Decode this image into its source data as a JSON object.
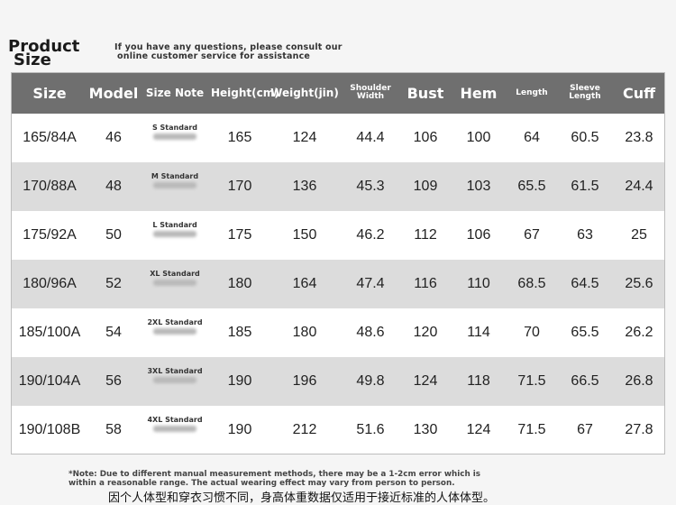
{
  "header": {
    "title_line1": "Product",
    "title_line2": "Size",
    "consult_line1": "If you have any questions, please consult our",
    "consult_line2": "online customer service for assistance"
  },
  "columns": [
    {
      "key": "size",
      "label": "Size"
    },
    {
      "key": "model",
      "label": "Model"
    },
    {
      "key": "note",
      "label": "Size Note"
    },
    {
      "key": "height",
      "label": "Height(cm)"
    },
    {
      "key": "weight",
      "label": "Weight(jin)"
    },
    {
      "key": "shoulder",
      "label": "Shoulder Width"
    },
    {
      "key": "bust",
      "label": "Bust"
    },
    {
      "key": "hem",
      "label": "Hem"
    },
    {
      "key": "length",
      "label": "Length"
    },
    {
      "key": "sleeve",
      "label": "Sleeve Length"
    },
    {
      "key": "cuff",
      "label": "Cuff"
    }
  ],
  "rows": [
    {
      "size": "165/84A",
      "model": "46",
      "note": "S Standard",
      "height": "165",
      "weight": "124",
      "shoulder": "44.4",
      "bust": "106",
      "hem": "100",
      "length": "64",
      "sleeve": "60.5",
      "cuff": "23.8"
    },
    {
      "size": "170/88A",
      "model": "48",
      "note": "M Standard",
      "height": "170",
      "weight": "136",
      "shoulder": "45.3",
      "bust": "109",
      "hem": "103",
      "length": "65.5",
      "sleeve": "61.5",
      "cuff": "24.4"
    },
    {
      "size": "175/92A",
      "model": "50",
      "note": "L Standard",
      "height": "175",
      "weight": "150",
      "shoulder": "46.2",
      "bust": "112",
      "hem": "106",
      "length": "67",
      "sleeve": "63",
      "cuff": "25"
    },
    {
      "size": "180/96A",
      "model": "52",
      "note": "XL Standard",
      "height": "180",
      "weight": "164",
      "shoulder": "47.4",
      "bust": "116",
      "hem": "110",
      "length": "68.5",
      "sleeve": "64.5",
      "cuff": "25.6"
    },
    {
      "size": "185/100A",
      "model": "54",
      "note": "2XL Standard",
      "height": "185",
      "weight": "180",
      "shoulder": "48.6",
      "bust": "120",
      "hem": "114",
      "length": "70",
      "sleeve": "65.5",
      "cuff": "26.2"
    },
    {
      "size": "190/104A",
      "model": "56",
      "note": "3XL Standard",
      "height": "190",
      "weight": "196",
      "shoulder": "49.8",
      "bust": "124",
      "hem": "118",
      "length": "71.5",
      "sleeve": "66.5",
      "cuff": "26.8"
    },
    {
      "size": "190/108B",
      "model": "58",
      "note": "4XL Standard",
      "height": "190",
      "weight": "212",
      "shoulder": "51.6",
      "bust": "130",
      "hem": "124",
      "length": "71.5",
      "sleeve": "67",
      "cuff": "27.8"
    }
  ],
  "footer": {
    "note_line1": "*Note: Due to different manual measurement methods, there may be a 1-2cm error which is",
    "note_line2": "within a reasonable range. The actual wearing effect may vary from person to person.",
    "chinese": "因个人体型和穿衣习惯不同，身高体重数据仅适用于接近标准的人体体型。"
  },
  "colors": {
    "header_bg": "#6f6f6f",
    "row_odd": "#ffffff",
    "row_even": "#dcdcdc"
  }
}
